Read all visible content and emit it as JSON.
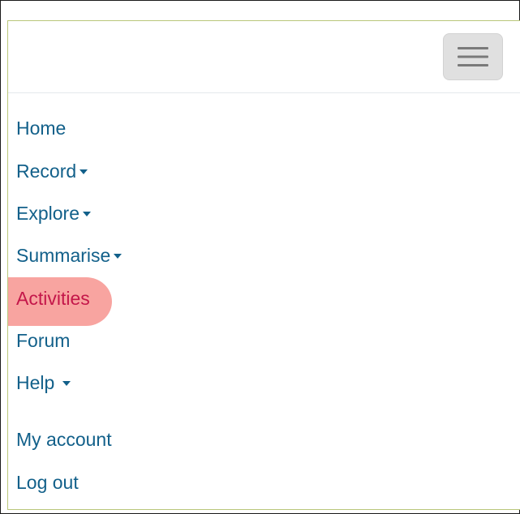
{
  "navbar": {
    "toggler_icon": "hamburger-menu-icon"
  },
  "menu": {
    "items": [
      {
        "label": "Home",
        "has_dropdown": false
      },
      {
        "label": "Record",
        "has_dropdown": true
      },
      {
        "label": "Explore",
        "has_dropdown": true
      },
      {
        "label": "Summarise",
        "has_dropdown": true
      },
      {
        "label": "Activities",
        "has_dropdown": false,
        "highlighted": true
      },
      {
        "label": "Forum",
        "has_dropdown": false
      },
      {
        "label": "Help",
        "has_dropdown": true
      },
      {
        "label": "My account",
        "has_dropdown": false
      },
      {
        "label": "Log out",
        "has_dropdown": false
      }
    ]
  },
  "colors": {
    "link": "#12608a",
    "highlight_marker": "#f79c98",
    "highlighted_text": "#c4174a",
    "toggler_bg": "#e0e0e0",
    "panel_border": "#b9c77a"
  }
}
